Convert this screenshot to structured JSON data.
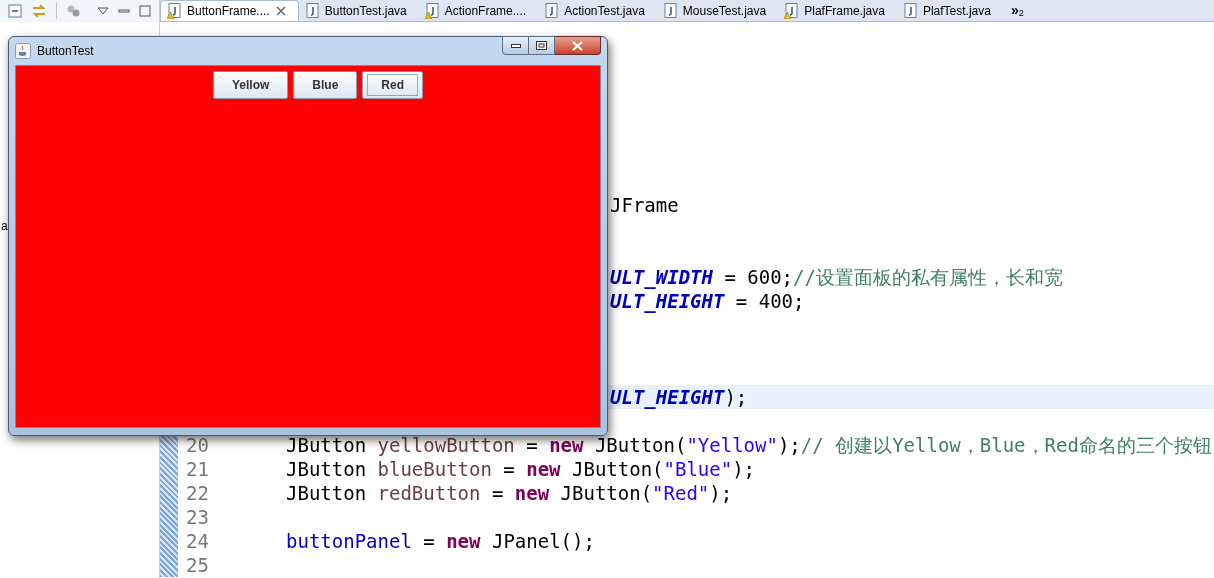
{
  "sidebar": {
    "cut_text": "a"
  },
  "editor_tabs": [
    {
      "label": "ButtonFrame....",
      "selected": true,
      "warning": true,
      "closable": true
    },
    {
      "label": "ButtonTest.java",
      "selected": false,
      "warning": false,
      "closable": false
    },
    {
      "label": "ActionFrame....",
      "selected": false,
      "warning": true,
      "closable": false
    },
    {
      "label": "ActionTest.java",
      "selected": false,
      "warning": false,
      "closable": false
    },
    {
      "label": "MouseTest.java",
      "selected": false,
      "warning": false,
      "closable": false
    },
    {
      "label": "PlafFrame.java",
      "selected": false,
      "warning": true,
      "closable": false
    },
    {
      "label": "PlafTest.java",
      "selected": false,
      "warning": false,
      "closable": false
    }
  ],
  "tabs_overflow": {
    "symbol": "»",
    "count": "2"
  },
  "code_lines": [
    {
      "current_line": false
    },
    {
      "current_line": false
    },
    {
      "current_line": false
    },
    {
      "current_line": false
    },
    {
      "current_line": false
    },
    {
      "current_line": false
    },
    {
      "current_line": false
    },
    {
      "current_line": false,
      "partial": true,
      "segments": [
        {
          "text": "JFrame",
          "kind": "plain"
        }
      ]
    },
    {
      "current_line": false
    },
    {
      "current_line": false
    },
    {
      "current_line": false,
      "partial": true,
      "segments": [
        {
          "text": "ULT_WIDTH",
          "kind": "constant"
        },
        {
          "text": " = 600;",
          "kind": "plain"
        },
        {
          "text": "//设置面板的私有属性，长和宽",
          "kind": "comment"
        }
      ]
    },
    {
      "current_line": false,
      "partial": true,
      "segments": [
        {
          "text": "ULT_HEIGHT",
          "kind": "constant"
        },
        {
          "text": " = 400;",
          "kind": "plain"
        }
      ]
    },
    {
      "current_line": false
    },
    {
      "current_line": false
    },
    {
      "current_line": false
    },
    {
      "current_line": true,
      "partial": true,
      "segments": [
        {
          "text": "ULT_HEIGHT",
          "kind": "constant"
        },
        {
          "text": ");",
          "kind": "plain"
        }
      ]
    },
    {
      "current_line": false
    },
    {
      "number": "20",
      "current_line": false,
      "partial": false,
      "segments": [
        {
          "text": "JButton ",
          "kind": "plain"
        },
        {
          "text": "yellowButton",
          "kind": "local"
        },
        {
          "text": " = ",
          "kind": "plain"
        },
        {
          "text": "new",
          "kind": "keyword"
        },
        {
          "text": " JButton(",
          "kind": "plain"
        },
        {
          "text": "\"Yellow\"",
          "kind": "string"
        },
        {
          "text": ");",
          "kind": "plain"
        },
        {
          "text": "// 创建以Yellow，Blue，Red命名的三个按钮",
          "kind": "comment"
        }
      ]
    },
    {
      "number": "21",
      "current_line": false,
      "partial": false,
      "segments": [
        {
          "text": "JButton ",
          "kind": "plain"
        },
        {
          "text": "blueButton",
          "kind": "local"
        },
        {
          "text": " = ",
          "kind": "plain"
        },
        {
          "text": "new",
          "kind": "keyword"
        },
        {
          "text": " JButton(",
          "kind": "plain"
        },
        {
          "text": "\"Blue\"",
          "kind": "string"
        },
        {
          "text": ");",
          "kind": "plain"
        }
      ]
    },
    {
      "number": "22",
      "current_line": false,
      "partial": false,
      "segments": [
        {
          "text": "JButton ",
          "kind": "plain"
        },
        {
          "text": "redButton",
          "kind": "local"
        },
        {
          "text": " = ",
          "kind": "plain"
        },
        {
          "text": "new",
          "kind": "keyword"
        },
        {
          "text": " JButton(",
          "kind": "plain"
        },
        {
          "text": "\"Red\"",
          "kind": "string"
        },
        {
          "text": ");",
          "kind": "plain"
        }
      ]
    },
    {
      "number": "23",
      "current_line": false
    },
    {
      "number": "24",
      "current_line": false,
      "partial": false,
      "segments": [
        {
          "text": "buttonPanel",
          "kind": "field"
        },
        {
          "text": " = ",
          "kind": "plain"
        },
        {
          "text": "new",
          "kind": "keyword"
        },
        {
          "text": " JPanel();",
          "kind": "plain"
        }
      ]
    },
    {
      "number": "25",
      "current_line": false
    }
  ],
  "window": {
    "title": "ButtonTest",
    "buttons": [
      {
        "label": "Yellow",
        "focused": false
      },
      {
        "label": "Blue",
        "focused": false
      },
      {
        "label": "Red",
        "focused": true
      }
    ]
  }
}
